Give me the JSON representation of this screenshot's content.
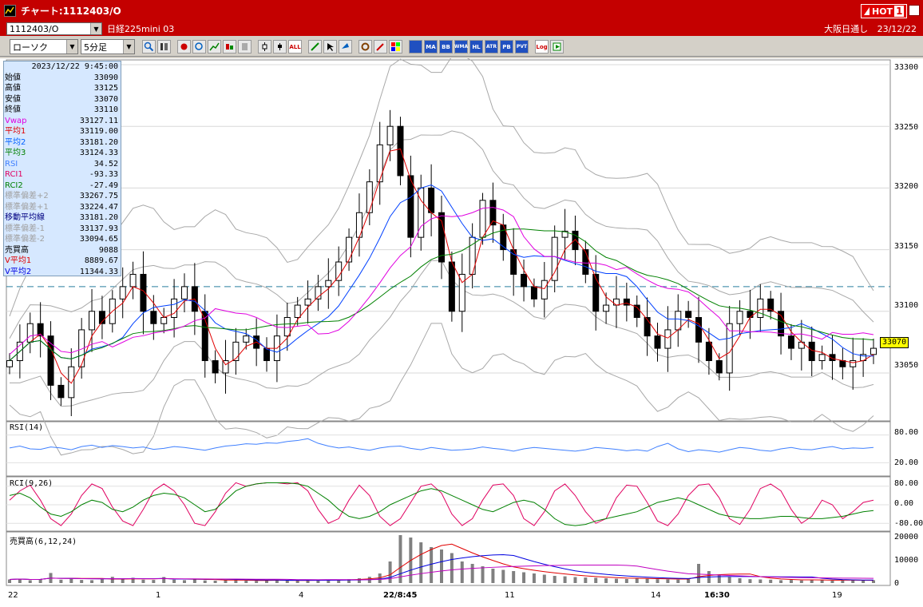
{
  "window": {
    "title": "チャート:1112403/O",
    "hot_label": "HOT",
    "hot_number": "1"
  },
  "symbol_bar": {
    "symbol_code": "1112403/O",
    "instrument_name": "日経225mini 03",
    "session": "大阪日通し",
    "date": "23/12/22"
  },
  "toolbar": {
    "chart_type": "ローソク",
    "period": "5分足",
    "icons": [
      "zoom-icon",
      "width-icon",
      "bookmark-icon",
      "search-chart-icon",
      "trend-icon",
      "compare-icon",
      "delete-icon",
      "candle-icon",
      "plusminus-icon",
      "all-icon",
      "pen-icon",
      "cursor-icon",
      "arrow-icon",
      "settings-icon",
      "tools-icon",
      "color-icon",
      "grid-icon",
      "ma-icon",
      "bb-icon",
      "wma-icon",
      "hl-icon",
      "atr-icon",
      "pb-icon",
      "pvt-icon",
      "log-icon",
      "export-icon"
    ],
    "text_buttons": {
      "all": "ALL",
      "ma": "MA",
      "bb": "BB",
      "wma": "WMA",
      "hl": "HL",
      "atr": "ATR",
      "pb": "PB",
      "pvt": "PVT",
      "log": "Log"
    }
  },
  "info_panel": {
    "datetime": "2023/12/22  9:45:00",
    "rows": [
      {
        "label": "始値",
        "value": "33090",
        "color": "#000000"
      },
      {
        "label": "高値",
        "value": "33125",
        "color": "#000000"
      },
      {
        "label": "安値",
        "value": "33070",
        "color": "#000000"
      },
      {
        "label": "終値",
        "value": "33110",
        "color": "#000000"
      },
      {
        "label": "Vwap",
        "value": "33127.11",
        "color": "#e000e0"
      },
      {
        "label": "平均1",
        "value": "33119.00",
        "color": "#e00000"
      },
      {
        "label": "平均2",
        "value": "33181.20",
        "color": "#0060ff"
      },
      {
        "label": "平均3",
        "value": "33124.33",
        "color": "#008000"
      },
      {
        "label": "RSI",
        "value": "34.52",
        "color": "#4080ff"
      },
      {
        "label": "RCI1",
        "value": "-93.33",
        "color": "#e00060"
      },
      {
        "label": "RCI2",
        "value": "-27.49",
        "color": "#008000"
      },
      {
        "label": "標準偏差+2",
        "value": "33267.75",
        "color": "#a0a0a0"
      },
      {
        "label": "標準偏差+1",
        "value": "33224.47",
        "color": "#a0a0a0"
      },
      {
        "label": "移動平均線",
        "value": "33181.20",
        "color": "#000080"
      },
      {
        "label": "標準偏差-1",
        "value": "33137.93",
        "color": "#a0a0a0"
      },
      {
        "label": "標準偏差-2",
        "value": "33094.65",
        "color": "#a0a0a0"
      },
      {
        "label": "売買高",
        "value": "9088",
        "color": "#000000"
      },
      {
        "label": "V平均1",
        "value": "8889.67",
        "color": "#e00000"
      },
      {
        "label": "V平均2",
        "value": "11344.33",
        "color": "#0000e0"
      }
    ]
  },
  "price_axis": [
    "33300",
    "33250",
    "33200",
    "33150",
    "33100",
    "33050"
  ],
  "current_price": "33070",
  "rsi_pane": {
    "label": "RSI(14)",
    "ticks": [
      "80.00",
      "20.00"
    ]
  },
  "rci_pane": {
    "label": "RCI(9,26)",
    "ticks": [
      "80.00",
      "0.00",
      "-80.00"
    ]
  },
  "volume_pane": {
    "label": "売買高(6,12,24)",
    "ticks": [
      "20000",
      "10000",
      "0"
    ]
  },
  "x_axis": [
    "22",
    "1",
    "4",
    "22/8:45",
    "11",
    "14",
    "16:30",
    "19"
  ],
  "chart_data": [
    {
      "type": "candlestick",
      "title": "",
      "ylim": [
        33015,
        33300
      ],
      "close_approx": [
        33060,
        33075,
        33090,
        33080,
        33040,
        33030,
        33055,
        33085,
        33100,
        33090,
        33110,
        33120,
        33130,
        33100,
        33090,
        33095,
        33110,
        33120,
        33100,
        33060,
        33050,
        33060,
        33075,
        33080,
        33070,
        33060,
        33080,
        33095,
        33105,
        33110,
        33120,
        33125,
        33140,
        33160,
        33180,
        33205,
        33235,
        33250,
        33210,
        33160,
        33200,
        33180,
        33140,
        33100,
        33130,
        33160,
        33190,
        33170,
        33150,
        33130,
        33120,
        33110,
        33125,
        33160,
        33165,
        33150,
        33130,
        33100,
        33105,
        33110,
        33105,
        33095,
        33080,
        33070,
        33085,
        33100,
        33095,
        33075,
        33060,
        33050,
        33090,
        33100,
        33095,
        33110,
        33100,
        33080,
        33070,
        33075,
        33060,
        33065,
        33060,
        33055,
        33060,
        33065,
        33070
      ],
      "series": [
        {
          "name": "平均1",
          "color": "#e00000"
        },
        {
          "name": "平均2",
          "color": "#0040ff"
        },
        {
          "name": "平均3",
          "color": "#008000"
        },
        {
          "name": "Vwap",
          "color": "#e000e0"
        }
      ],
      "reference_line": 33120
    },
    {
      "type": "line",
      "title": "RSI(14)",
      "ylim": [
        0,
        100
      ],
      "values": [
        52,
        56,
        50,
        49,
        54,
        52,
        48,
        55,
        58,
        53,
        57,
        55,
        52,
        54,
        49,
        51,
        55,
        53,
        50,
        47,
        52,
        56,
        58,
        61,
        60,
        63,
        62,
        66,
        68,
        72,
        62,
        56,
        52,
        54,
        50,
        47,
        52,
        55,
        56,
        51,
        48,
        53,
        50,
        47,
        48,
        50,
        54,
        51,
        49,
        45,
        50,
        53,
        51,
        49,
        47,
        45,
        48,
        53,
        51,
        49,
        46,
        48,
        45,
        55,
        62,
        50,
        44,
        48,
        46,
        43,
        48,
        53,
        51,
        47,
        45,
        50,
        53,
        49,
        48,
        52,
        55,
        50,
        52,
        51,
        53
      ]
    },
    {
      "type": "line",
      "title": "RCI(9,26)",
      "ylim": [
        -100,
        100
      ],
      "series": [
        {
          "name": "RCI1",
          "color": "#e00060",
          "values": [
            20,
            60,
            85,
            20,
            -60,
            -90,
            -40,
            40,
            90,
            70,
            -10,
            -70,
            -90,
            -20,
            60,
            90,
            60,
            0,
            -80,
            -90,
            -30,
            50,
            95,
            80,
            90,
            95,
            95,
            90,
            95,
            60,
            -20,
            -80,
            -60,
            20,
            85,
            40,
            -50,
            -90,
            -60,
            10,
            80,
            90,
            50,
            -40,
            -90,
            -60,
            20,
            85,
            90,
            40,
            -60,
            -90,
            -30,
            60,
            90,
            40,
            -30,
            -80,
            -60,
            30,
            85,
            80,
            10,
            -70,
            -90,
            -40,
            40,
            85,
            90,
            30,
            -60,
            -85,
            -20,
            70,
            90,
            60,
            -20,
            -80,
            -50,
            20,
            0,
            -60,
            -30,
            10,
            20
          ]
        },
        {
          "name": "RCI2",
          "color": "#008000",
          "values": [
            40,
            50,
            30,
            -10,
            -40,
            -50,
            -30,
            0,
            20,
            10,
            -20,
            -30,
            -10,
            20,
            40,
            50,
            45,
            30,
            0,
            -30,
            -20,
            20,
            60,
            80,
            90,
            95,
            95,
            95,
            90,
            80,
            50,
            20,
            -20,
            -50,
            -60,
            -50,
            -30,
            0,
            20,
            40,
            60,
            70,
            60,
            40,
            20,
            0,
            -20,
            -30,
            -10,
            10,
            20,
            10,
            -20,
            -60,
            -85,
            -90,
            -85,
            -70,
            -60,
            -50,
            -40,
            -30,
            -10,
            10,
            20,
            30,
            20,
            0,
            -20,
            -40,
            -50,
            -55,
            -60,
            -60,
            -55,
            -50,
            -50,
            -55,
            -60,
            -60,
            -55,
            -50,
            -40,
            -30,
            -25
          ]
        }
      ]
    },
    {
      "type": "bar",
      "title": "売買高(6,12,24)",
      "ylim": [
        0,
        20000
      ],
      "values": [
        1500,
        1800,
        1200,
        1600,
        4200,
        1400,
        1800,
        1300,
        1200,
        1600,
        2600,
        1500,
        2200,
        1400,
        1300,
        2500,
        1400,
        1200,
        1600,
        1100,
        1000,
        1200,
        1400,
        1000,
        900,
        1100,
        1300,
        1000,
        1100,
        1200,
        1300,
        1500,
        1400,
        1600,
        2000,
        2600,
        4000,
        9000,
        20000,
        19000,
        17000,
        15000,
        14000,
        12500,
        9000,
        8000,
        7000,
        6000,
        5500,
        5000,
        4500,
        4000,
        3500,
        3000,
        2800,
        2500,
        2300,
        2200,
        2000,
        1800,
        1700,
        2000,
        1800,
        1600,
        1500,
        1400,
        1600,
        8000,
        5000,
        3500,
        2500,
        2000,
        1600,
        1500,
        1400,
        1200,
        1300,
        1100,
        1500,
        1200,
        1000,
        1100,
        1300,
        1000,
        1200
      ]
    }
  ]
}
